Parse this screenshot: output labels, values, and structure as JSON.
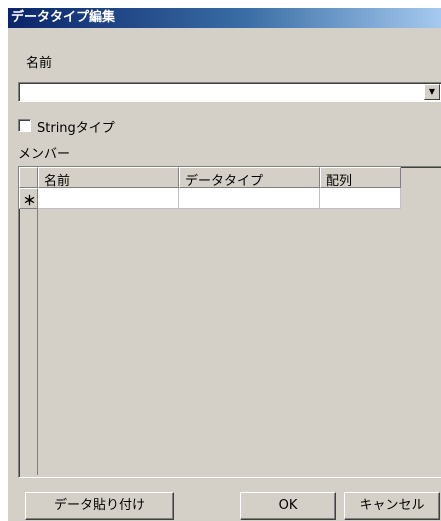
{
  "window": {
    "title": "データタイプ編集"
  },
  "name_label": "名前",
  "name_combo": {
    "value": "",
    "arrow_icon": "chevron-down-icon"
  },
  "string_type_checkbox": {
    "label": "Stringタイプ",
    "checked": false
  },
  "members_label": "メンバー",
  "members_grid": {
    "columns": [
      "名前",
      "データタイプ",
      "配列"
    ],
    "new_row_marker": "＊",
    "rows": [
      {
        "name": "",
        "data_type": "",
        "array": ""
      }
    ]
  },
  "buttons": {
    "paste": "データ貼り付け",
    "ok": "OK",
    "cancel": "キャンセル"
  }
}
